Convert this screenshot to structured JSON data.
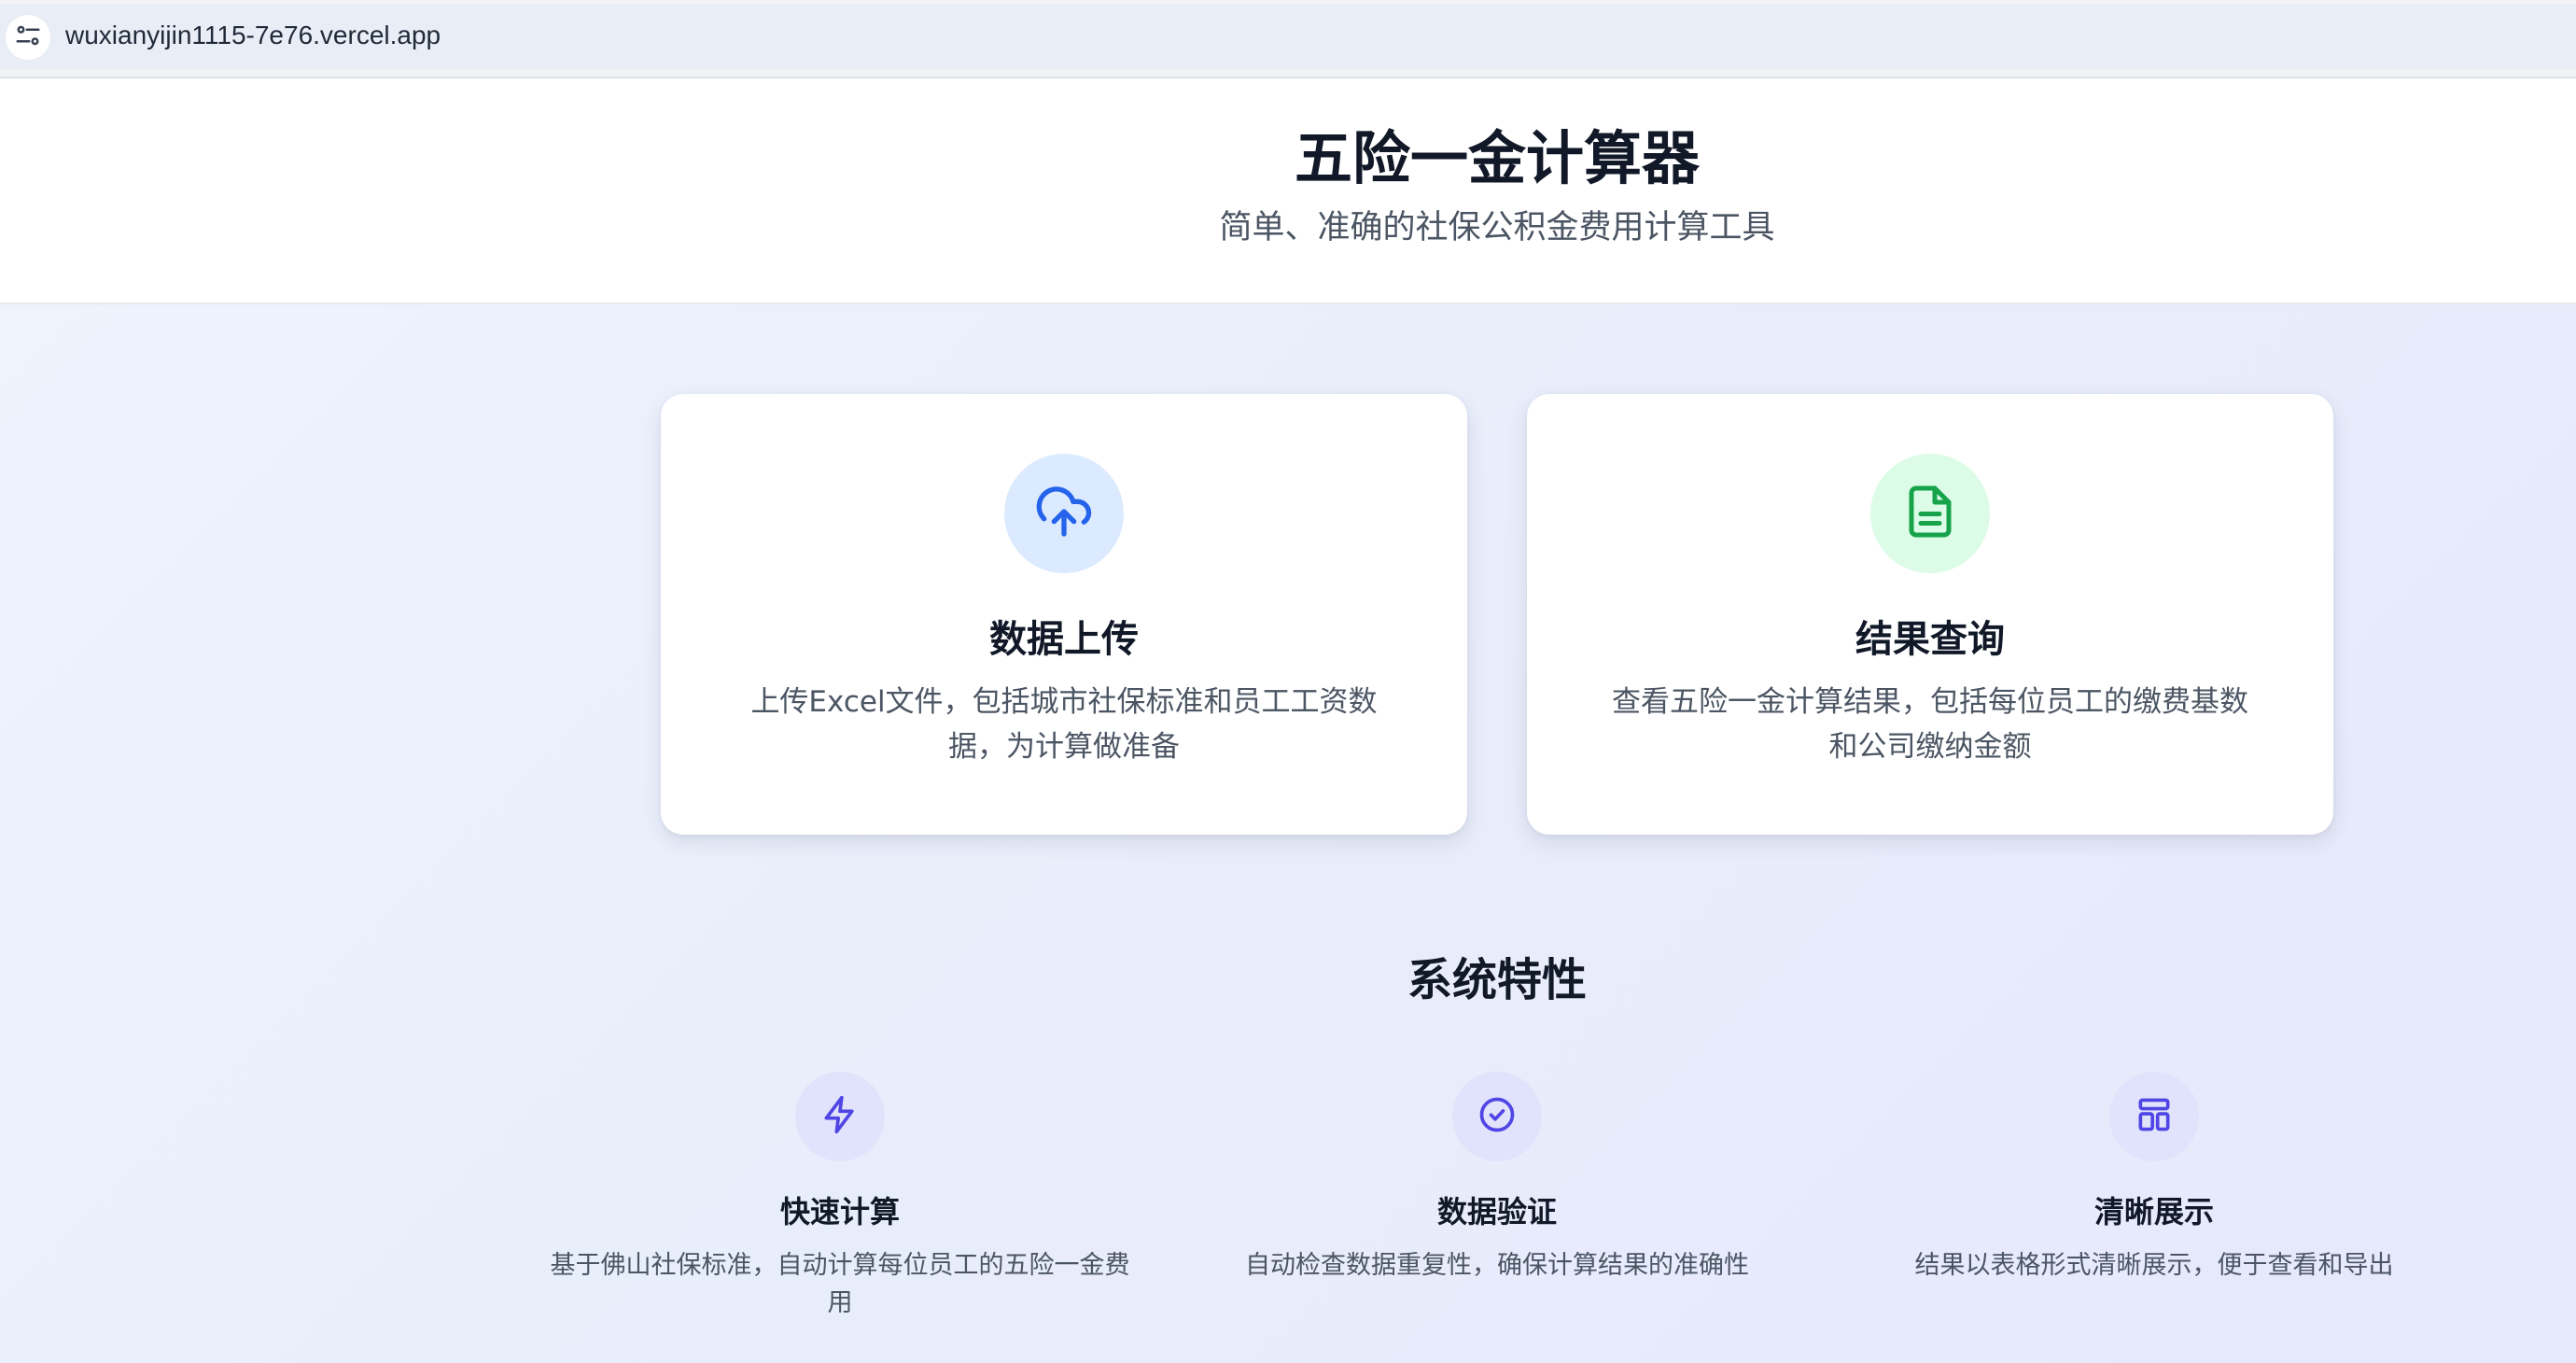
{
  "browser": {
    "url": "wuxianyijin1115-7e76.vercel.app",
    "site_info_icon": "tune-icon"
  },
  "header": {
    "title": "五险一金计算器",
    "subtitle": "简单、准确的社保公积金费用计算工具"
  },
  "cards": [
    {
      "icon": "cloud-upload-icon",
      "title": "数据上传",
      "description": "上传Excel文件，包括城市社保标准和员工工资数据，为计算做准备",
      "accent": "#2563eb",
      "icon_bg": "#dbeafe"
    },
    {
      "icon": "document-icon",
      "title": "结果查询",
      "description": "查看五险一金计算结果，包括每位员工的缴费基数和公司缴纳金额",
      "accent": "#16a34a",
      "icon_bg": "#dcfce7"
    }
  ],
  "features": {
    "title": "系统特性",
    "items": [
      {
        "icon": "lightning-icon",
        "title": "快速计算",
        "description": "基于佛山社保标准，自动计算每位员工的五险一金费用"
      },
      {
        "icon": "check-circle-icon",
        "title": "数据验证",
        "description": "自动检查数据重复性，确保计算结果的准确性"
      },
      {
        "icon": "layout-icon",
        "title": "清晰展示",
        "description": "结果以表格形式清晰展示，便于查看和导出"
      }
    ],
    "accent": "#4f46e5",
    "icon_bg": "#e0e3fb"
  }
}
